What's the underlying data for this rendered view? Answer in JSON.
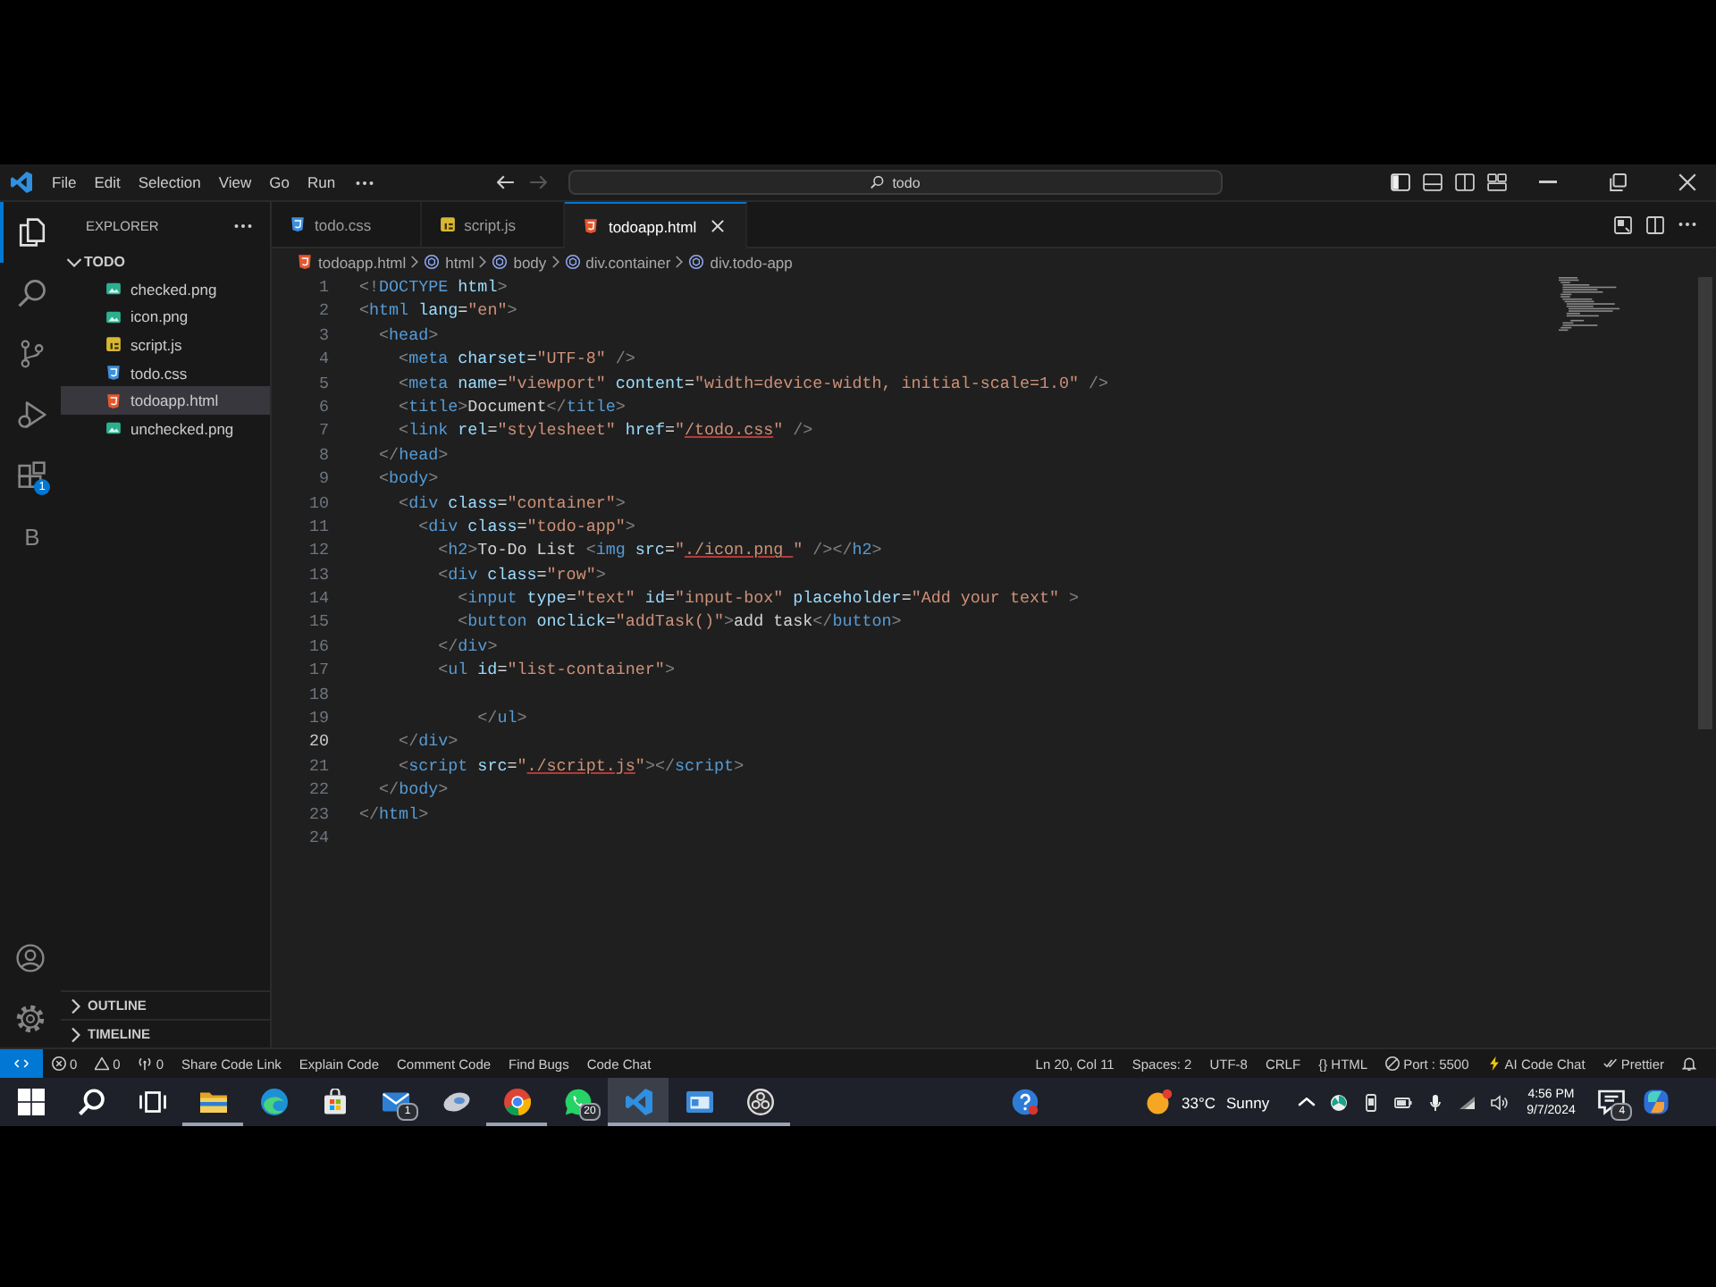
{
  "window": {
    "menu": [
      "File",
      "Edit",
      "Selection",
      "View",
      "Go",
      "Run"
    ],
    "command_center": {
      "value": "todo"
    }
  },
  "activity_bar": {
    "items": [
      {
        "kind": "explorer",
        "selected": true
      },
      {
        "kind": "search",
        "selected": false
      },
      {
        "kind": "source-control",
        "selected": false
      },
      {
        "kind": "run-debug",
        "selected": false
      },
      {
        "kind": "extensions",
        "selected": false,
        "badge": "1"
      },
      {
        "kind": "letter",
        "selected": false,
        "label": "B"
      }
    ]
  },
  "sidebar": {
    "title": "EXPLORER",
    "tree": [
      {
        "label": "TODO",
        "expanded": true,
        "children": [
          {
            "label": "checked.png",
            "kind": "image",
            "selected": false
          },
          {
            "label": "icon.png",
            "kind": "image",
            "selected": false
          },
          {
            "label": "script.js",
            "kind": "js",
            "selected": false
          },
          {
            "label": "todo.css",
            "kind": "css",
            "selected": false
          },
          {
            "label": "todoapp.html",
            "kind": "html",
            "selected": true
          },
          {
            "label": "unchecked.png",
            "kind": "image",
            "selected": false
          }
        ]
      }
    ],
    "sections": [
      {
        "label": "OUTLINE",
        "expanded": false
      },
      {
        "label": "TIMELINE",
        "expanded": false
      }
    ]
  },
  "tabs": [
    {
      "label": "todo.css",
      "kind": "css",
      "selected": false
    },
    {
      "label": "script.js",
      "kind": "js",
      "selected": false
    },
    {
      "label": "todoapp.html",
      "kind": "html",
      "selected": true
    }
  ],
  "breadcrumbs": [
    {
      "label": "todoapp.html",
      "kind": "file"
    },
    {
      "label": "html",
      "kind": "element"
    },
    {
      "label": "body",
      "kind": "element"
    },
    {
      "label": "div.container",
      "kind": "element"
    },
    {
      "label": "div.todo-app",
      "kind": "element"
    }
  ],
  "editor": {
    "lines": [
      {
        "number": "1",
        "active": false,
        "tokens": [
          {
            "kind": "punct",
            "text": "<!"
          },
          {
            "kind": "tag",
            "text": "DOCTYPE"
          },
          {
            "kind": "attr",
            "text": " html"
          },
          {
            "kind": "punct",
            "text": ">"
          }
        ]
      },
      {
        "number": "2",
        "active": false,
        "tokens": [
          {
            "kind": "punct",
            "text": "<"
          },
          {
            "kind": "tag",
            "text": "html"
          },
          {
            "kind": "attr",
            "text": " lang"
          },
          {
            "kind": "text",
            "text": "="
          },
          {
            "kind": "string",
            "text": "\"en\""
          },
          {
            "kind": "punct",
            "text": ">"
          }
        ]
      },
      {
        "number": "3",
        "active": false,
        "tokens": [
          {
            "kind": "punct",
            "text": "  <"
          },
          {
            "kind": "tag",
            "text": "head"
          },
          {
            "kind": "punct",
            "text": ">"
          }
        ]
      },
      {
        "number": "4",
        "active": false,
        "tokens": [
          {
            "kind": "punct",
            "text": "    <"
          },
          {
            "kind": "tag",
            "text": "meta"
          },
          {
            "kind": "attr",
            "text": " charset"
          },
          {
            "kind": "text",
            "text": "="
          },
          {
            "kind": "string",
            "text": "\"UTF-8\""
          },
          {
            "kind": "punct",
            "text": " />"
          }
        ]
      },
      {
        "number": "5",
        "active": false,
        "tokens": [
          {
            "kind": "punct",
            "text": "    <"
          },
          {
            "kind": "tag",
            "text": "meta"
          },
          {
            "kind": "attr",
            "text": " name"
          },
          {
            "kind": "text",
            "text": "="
          },
          {
            "kind": "string",
            "text": "\"viewport\""
          },
          {
            "kind": "attr",
            "text": " content"
          },
          {
            "kind": "text",
            "text": "="
          },
          {
            "kind": "string",
            "text": "\"width=device-width, initial-scale=1.0\""
          },
          {
            "kind": "punct",
            "text": " />"
          }
        ]
      },
      {
        "number": "6",
        "active": false,
        "tokens": [
          {
            "kind": "punct",
            "text": "    <"
          },
          {
            "kind": "tag",
            "text": "title"
          },
          {
            "kind": "punct",
            "text": ">"
          },
          {
            "kind": "text",
            "text": "Document"
          },
          {
            "kind": "punct",
            "text": "</"
          },
          {
            "kind": "tag",
            "text": "title"
          },
          {
            "kind": "punct",
            "text": ">"
          }
        ]
      },
      {
        "number": "7",
        "active": false,
        "tokens": [
          {
            "kind": "punct",
            "text": "    <"
          },
          {
            "kind": "tag",
            "text": "link"
          },
          {
            "kind": "attr",
            "text": " rel"
          },
          {
            "kind": "text",
            "text": "="
          },
          {
            "kind": "string",
            "text": "\"stylesheet\""
          },
          {
            "kind": "attr",
            "text": " href"
          },
          {
            "kind": "text",
            "text": "="
          },
          {
            "kind": "string",
            "text": "\""
          },
          {
            "kind": "path",
            "text": "/todo.css"
          },
          {
            "kind": "string",
            "text": "\""
          },
          {
            "kind": "punct",
            "text": " />"
          }
        ]
      },
      {
        "number": "8",
        "active": false,
        "tokens": [
          {
            "kind": "punct",
            "text": "  </"
          },
          {
            "kind": "tag",
            "text": "head"
          },
          {
            "kind": "punct",
            "text": ">"
          }
        ]
      },
      {
        "number": "9",
        "active": false,
        "tokens": [
          {
            "kind": "punct",
            "text": "  <"
          },
          {
            "kind": "tag",
            "text": "body"
          },
          {
            "kind": "punct",
            "text": ">"
          }
        ]
      },
      {
        "number": "10",
        "active": false,
        "tokens": [
          {
            "kind": "punct",
            "text": "    <"
          },
          {
            "kind": "tag",
            "text": "div"
          },
          {
            "kind": "attr",
            "text": " class"
          },
          {
            "kind": "text",
            "text": "="
          },
          {
            "kind": "string",
            "text": "\"container\""
          },
          {
            "kind": "punct",
            "text": ">"
          }
        ]
      },
      {
        "number": "11",
        "active": false,
        "tokens": [
          {
            "kind": "punct",
            "text": "      <"
          },
          {
            "kind": "tag",
            "text": "div"
          },
          {
            "kind": "attr",
            "text": " class"
          },
          {
            "kind": "text",
            "text": "="
          },
          {
            "kind": "string",
            "text": "\"todo-app\""
          },
          {
            "kind": "punct",
            "text": ">"
          }
        ]
      },
      {
        "number": "12",
        "active": false,
        "tokens": [
          {
            "kind": "punct",
            "text": "        <"
          },
          {
            "kind": "tag",
            "text": "h2"
          },
          {
            "kind": "punct",
            "text": ">"
          },
          {
            "kind": "text",
            "text": "To-Do List "
          },
          {
            "kind": "punct",
            "text": "<"
          },
          {
            "kind": "tag",
            "text": "img"
          },
          {
            "kind": "attr",
            "text": " src"
          },
          {
            "kind": "text",
            "text": "="
          },
          {
            "kind": "string",
            "text": "\""
          },
          {
            "kind": "path",
            "text": "./icon.png "
          },
          {
            "kind": "string",
            "text": "\""
          },
          {
            "kind": "punct",
            "text": " /></"
          },
          {
            "kind": "tag",
            "text": "h2"
          },
          {
            "kind": "punct",
            "text": ">"
          }
        ]
      },
      {
        "number": "13",
        "active": false,
        "tokens": [
          {
            "kind": "punct",
            "text": "        <"
          },
          {
            "kind": "tag",
            "text": "div"
          },
          {
            "kind": "attr",
            "text": " class"
          },
          {
            "kind": "text",
            "text": "="
          },
          {
            "kind": "string",
            "text": "\"row\""
          },
          {
            "kind": "punct",
            "text": ">"
          }
        ]
      },
      {
        "number": "14",
        "active": false,
        "tokens": [
          {
            "kind": "punct",
            "text": "          <"
          },
          {
            "kind": "tag",
            "text": "input"
          },
          {
            "kind": "attr",
            "text": " type"
          },
          {
            "kind": "text",
            "text": "="
          },
          {
            "kind": "string",
            "text": "\"text\""
          },
          {
            "kind": "attr",
            "text": " id"
          },
          {
            "kind": "text",
            "text": "="
          },
          {
            "kind": "string",
            "text": "\"input-box\""
          },
          {
            "kind": "attr",
            "text": " placeholder"
          },
          {
            "kind": "text",
            "text": "="
          },
          {
            "kind": "string",
            "text": "\"Add your text\""
          },
          {
            "kind": "punct",
            "text": " >"
          }
        ]
      },
      {
        "number": "15",
        "active": false,
        "tokens": [
          {
            "kind": "punct",
            "text": "          <"
          },
          {
            "kind": "tag",
            "text": "button"
          },
          {
            "kind": "attr",
            "text": " onclick"
          },
          {
            "kind": "text",
            "text": "="
          },
          {
            "kind": "string",
            "text": "\"addTask()\""
          },
          {
            "kind": "punct",
            "text": ">"
          },
          {
            "kind": "text",
            "text": "add task"
          },
          {
            "kind": "punct",
            "text": "</"
          },
          {
            "kind": "tag",
            "text": "button"
          },
          {
            "kind": "punct",
            "text": ">"
          }
        ]
      },
      {
        "number": "16",
        "active": false,
        "tokens": [
          {
            "kind": "punct",
            "text": "        </"
          },
          {
            "kind": "tag",
            "text": "div"
          },
          {
            "kind": "punct",
            "text": ">"
          }
        ]
      },
      {
        "number": "17",
        "active": false,
        "tokens": [
          {
            "kind": "punct",
            "text": "        <"
          },
          {
            "kind": "tag",
            "text": "ul"
          },
          {
            "kind": "attr",
            "text": " id"
          },
          {
            "kind": "text",
            "text": "="
          },
          {
            "kind": "string",
            "text": "\"list-container\""
          },
          {
            "kind": "punct",
            "text": ">"
          }
        ]
      },
      {
        "number": "18",
        "active": false
      },
      {
        "number": "19",
        "active": false,
        "tokens": [
          {
            "kind": "punct",
            "text": "            </"
          },
          {
            "kind": "tag",
            "text": "ul"
          },
          {
            "kind": "punct",
            "text": ">"
          }
        ]
      },
      {
        "number": "20",
        "active": true,
        "tokens": [
          {
            "kind": "punct",
            "text": "    </"
          },
          {
            "kind": "tag",
            "text": "div"
          },
          {
            "kind": "punct",
            "text": ">"
          }
        ]
      },
      {
        "number": "21",
        "active": false,
        "tokens": [
          {
            "kind": "punct",
            "text": "    <"
          },
          {
            "kind": "tag",
            "text": "script"
          },
          {
            "kind": "attr",
            "text": " src"
          },
          {
            "kind": "text",
            "text": "="
          },
          {
            "kind": "string",
            "text": "\""
          },
          {
            "kind": "path",
            "text": "./script.js"
          },
          {
            "kind": "string",
            "text": "\""
          },
          {
            "kind": "punct",
            "text": "></"
          },
          {
            "kind": "tag",
            "text": "script"
          },
          {
            "kind": "punct",
            "text": ">"
          }
        ]
      },
      {
        "number": "22",
        "active": false,
        "tokens": [
          {
            "kind": "punct",
            "text": "  </"
          },
          {
            "kind": "tag",
            "text": "body"
          },
          {
            "kind": "punct",
            "text": ">"
          }
        ]
      },
      {
        "number": "23",
        "active": false,
        "tokens": [
          {
            "kind": "punct",
            "text": "</"
          },
          {
            "kind": "tag",
            "text": "html"
          },
          {
            "kind": "punct",
            "text": ">"
          }
        ]
      },
      {
        "number": "24",
        "active": false
      }
    ]
  },
  "status_bar": {
    "left": [
      {
        "kind": "remote"
      },
      {
        "kind": "errors",
        "text": "0"
      },
      {
        "kind": "warnings",
        "text": "0"
      },
      {
        "kind": "ports",
        "text": "0"
      },
      {
        "kind": "text",
        "text": "Share Code Link"
      },
      {
        "kind": "text",
        "text": "Explain Code"
      },
      {
        "kind": "text",
        "text": "Comment Code"
      },
      {
        "kind": "text",
        "text": "Find Bugs"
      },
      {
        "kind": "text",
        "text": "Code Chat"
      }
    ],
    "right": [
      {
        "kind": "text",
        "text": "Ln 20, Col 11"
      },
      {
        "kind": "text",
        "text": "Spaces: 2"
      },
      {
        "kind": "text",
        "text": "UTF-8"
      },
      {
        "kind": "text",
        "text": "CRLF"
      },
      {
        "kind": "text",
        "text": "{} HTML"
      },
      {
        "kind": "port",
        "text": "Port : 5500"
      },
      {
        "kind": "ai",
        "text": "AI Code Chat"
      },
      {
        "kind": "prettier",
        "text": "Prettier"
      },
      {
        "kind": "bell"
      }
    ]
  },
  "taskbar": {
    "apps": [
      {
        "kind": "start",
        "running": false,
        "selected": false
      },
      {
        "kind": "search",
        "running": false,
        "selected": false
      },
      {
        "kind": "task-view",
        "running": false,
        "selected": false
      },
      {
        "kind": "folder",
        "running": true,
        "selected": false
      },
      {
        "kind": "swirl",
        "running": false,
        "selected": false
      },
      {
        "kind": "bag",
        "running": false,
        "selected": false
      },
      {
        "kind": "envelope",
        "running": false,
        "selected": false,
        "badge": "1"
      },
      {
        "kind": "pill",
        "running": false,
        "selected": false
      },
      {
        "kind": "segments",
        "running": true,
        "selected": false
      },
      {
        "kind": "chat",
        "running": false,
        "selected": false,
        "badge": "20"
      },
      {
        "kind": "ribbon",
        "running": true,
        "selected": true
      },
      {
        "kind": "window",
        "running": true,
        "selected": false
      },
      {
        "kind": "ring",
        "running": true,
        "selected": false
      }
    ],
    "weather": {
      "temperature": "33°C",
      "condition": "Sunny"
    },
    "clock": {
      "time": "4:56 PM",
      "date": "9/7/2024"
    },
    "notifications": {
      "badge": "4"
    }
  }
}
